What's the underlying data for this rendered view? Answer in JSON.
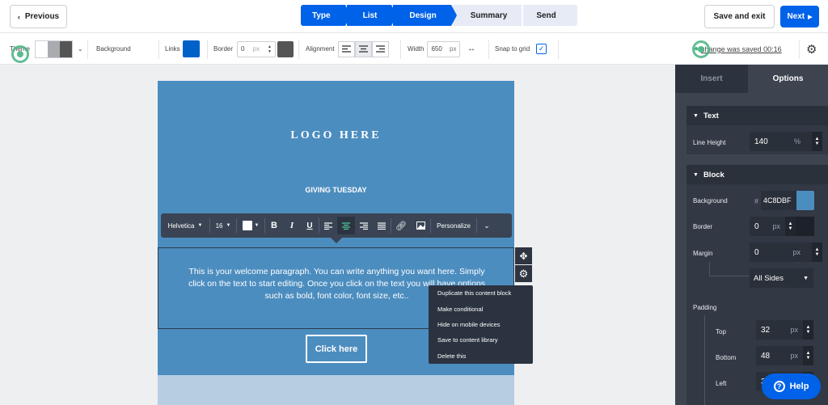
{
  "header": {
    "previous_label": "Previous",
    "steps": [
      "Type",
      "List",
      "Design",
      "Summary",
      "Send"
    ],
    "active_step": "Design",
    "save_exit_label": "Save and exit",
    "next_label": "Next"
  },
  "toolbar": {
    "theme_label": "Theme",
    "background_label": "Background",
    "links_label": "Links",
    "links_color": "#0062c8",
    "border_label": "Border",
    "border_value": "0",
    "border_unit": "px",
    "border_color": "#555555",
    "alignment_label": "Alignment",
    "width_label": "Width",
    "width_value": "650",
    "width_unit": "px",
    "snap_label": "Snap to grid",
    "snap_checked": true,
    "save_status": "change was saved 00:16"
  },
  "email": {
    "logo": "LOGO HERE",
    "heading": "GIVING TUESDAY",
    "paragraph": "This is your welcome paragraph. You can write anything you want here. Simply click on the text to start editing. Once you click on the text you will have options such as bold, font color, font size, etc..",
    "button": "Click here",
    "bg_color": "#4c8dbf"
  },
  "format_bar": {
    "font": "Helvetica",
    "size": "16",
    "personalize": "Personalize"
  },
  "context_menu": {
    "items": [
      "Duplicate this content block",
      "Make conditional",
      "Hide on mobile devices",
      "Save to content library",
      "Delete this"
    ]
  },
  "panel": {
    "tabs": [
      "Insert",
      "Options"
    ],
    "active_tab": "Options",
    "text_section": {
      "title": "Text",
      "line_height_label": "Line Height",
      "line_height_value": "140",
      "line_height_unit": "%"
    },
    "block_section": {
      "title": "Block",
      "background_label": "Background",
      "background_hash": "#",
      "background_value": "4C8DBF",
      "border_label": "Border",
      "border_value": "0",
      "border_unit": "px",
      "margin_label": "Margin",
      "margin_value": "0",
      "margin_unit": "px",
      "margin_sides": "All Sides",
      "padding_label": "Padding",
      "top_label": "Top",
      "top_value": "32",
      "bottom_label": "Bottom",
      "bottom_value": "48",
      "left_label": "Left",
      "left_value": "32",
      "unit": "px"
    }
  },
  "help_label": "Help"
}
